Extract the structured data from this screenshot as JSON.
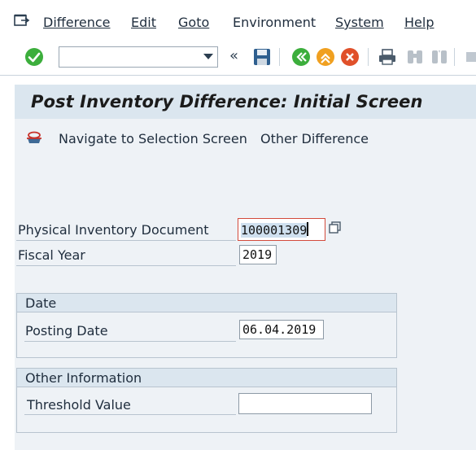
{
  "menu": {
    "items": [
      "Difference",
      "Edit",
      "Goto",
      "Environment",
      "System",
      "Help"
    ]
  },
  "toolbar": {
    "command_field_value": "",
    "back_glyph": "«"
  },
  "title": "Post Inventory Difference: Initial Screen",
  "app_toolbar": {
    "navigate": "Navigate to Selection Screen",
    "other": "Other Difference"
  },
  "fields": {
    "physinv_label": "Physical Inventory Document",
    "physinv_value": "100001309",
    "fiscal_year_label": "Fiscal Year",
    "fiscal_year_value": "2019"
  },
  "date_group": {
    "title": "Date",
    "posting_date_label": "Posting Date",
    "posting_date_value": "06.04.2019"
  },
  "other_group": {
    "title": "Other Information",
    "threshold_label": "Threshold Value",
    "threshold_value": ""
  },
  "colors": {
    "title_bg": "#dbe6ef",
    "app_bg": "#eef2f6",
    "focus_border": "#d34b3c",
    "enter_green": "#3cae3c"
  }
}
